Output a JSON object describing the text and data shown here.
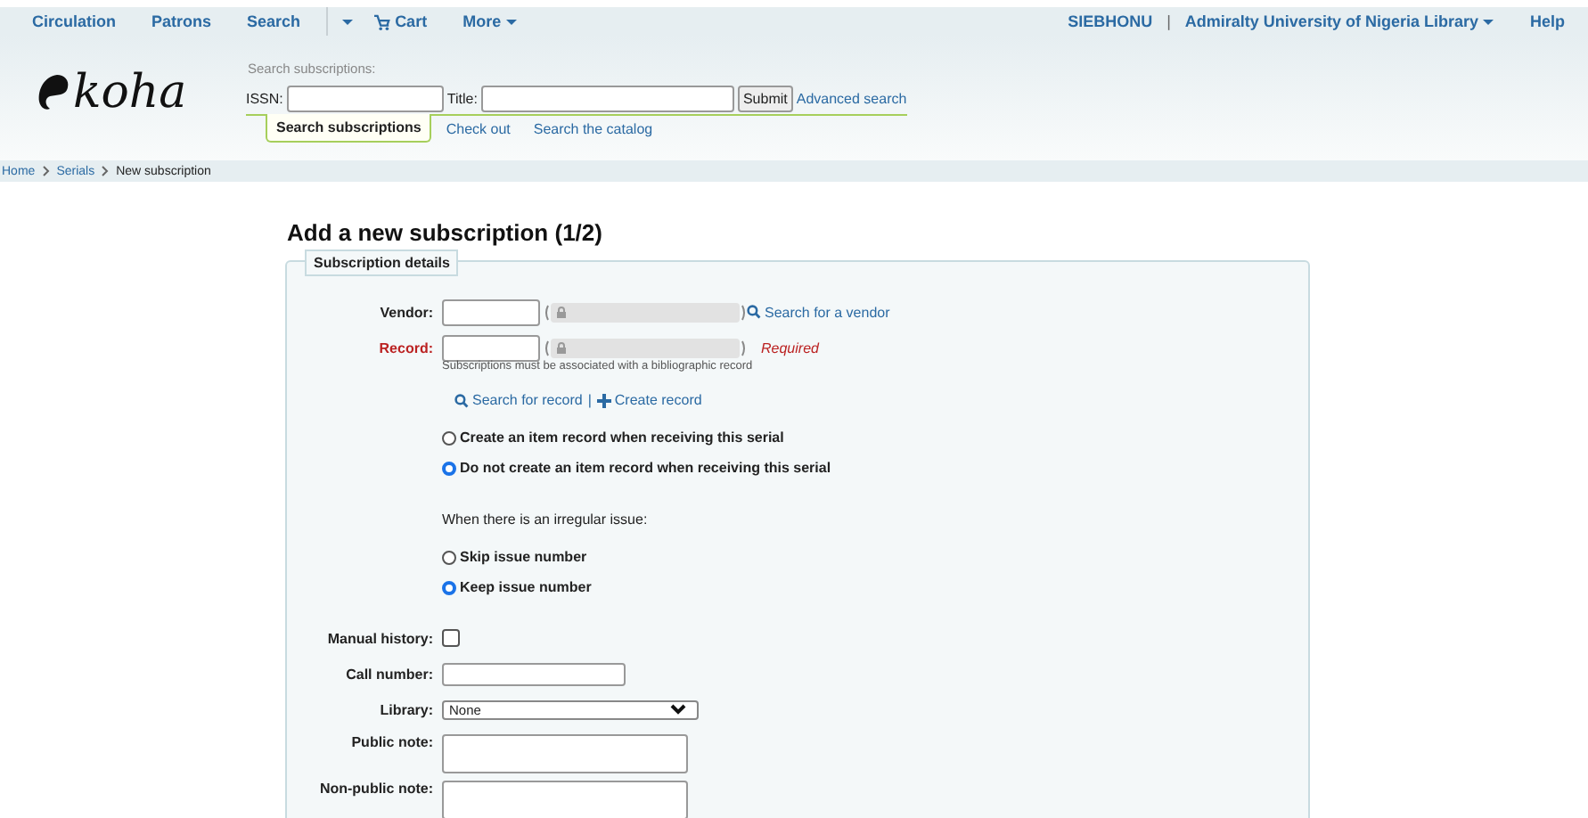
{
  "nav": {
    "items": [
      {
        "label": "Circulation",
        "kind": "link"
      },
      {
        "label": "Patrons",
        "kind": "link"
      },
      {
        "label": "Search",
        "kind": "link"
      },
      {
        "kind": "caret"
      },
      {
        "label": "Cart",
        "kind": "cart"
      },
      {
        "label": "More",
        "kind": "menu"
      }
    ],
    "user": "SIEBHONU",
    "separator": "|",
    "library": "Admiralty University of Nigeria Library",
    "help": "Help"
  },
  "header": {
    "logo": "koha",
    "search_title": "Search subscriptions:",
    "issn_label": "ISSN:",
    "title_label": "Title:",
    "submit": "Submit",
    "advanced": "Advanced search",
    "tabs": [
      {
        "label": "Search subscriptions",
        "selected": true
      },
      {
        "label": "Check out",
        "selected": false
      },
      {
        "label": "Search the catalog",
        "selected": false
      }
    ]
  },
  "breadcrumbs": [
    "Home",
    "Serials",
    "New subscription"
  ],
  "heading": "Add a new subscription (1/2)",
  "legend": "Subscription details",
  "vendor": {
    "label": "Vendor:",
    "link": "Search for a vendor"
  },
  "record": {
    "label": "Record:",
    "required": "Required",
    "hint": "Subscriptions must be associated with a bibliographic record",
    "search_link": "Search for record",
    "separator": "|",
    "create_link": "Create record"
  },
  "item_options": [
    {
      "label": "Create an item record when receiving this serial",
      "selected": false
    },
    {
      "label": "Do not create an item record when receiving this serial",
      "selected": true
    }
  ],
  "irregular_label": "When there is an irregular issue:",
  "irregular_options": [
    {
      "label": "Skip issue number",
      "selected": false
    },
    {
      "label": "Keep issue number",
      "selected": true
    }
  ],
  "manual_history": {
    "label": "Manual history:",
    "checked": false
  },
  "call_number": {
    "label": "Call number:"
  },
  "library": {
    "label": "Library:",
    "value": "None"
  },
  "public_note": {
    "label": "Public note:"
  },
  "nonpublic_note": {
    "label": "Non-public note:"
  }
}
